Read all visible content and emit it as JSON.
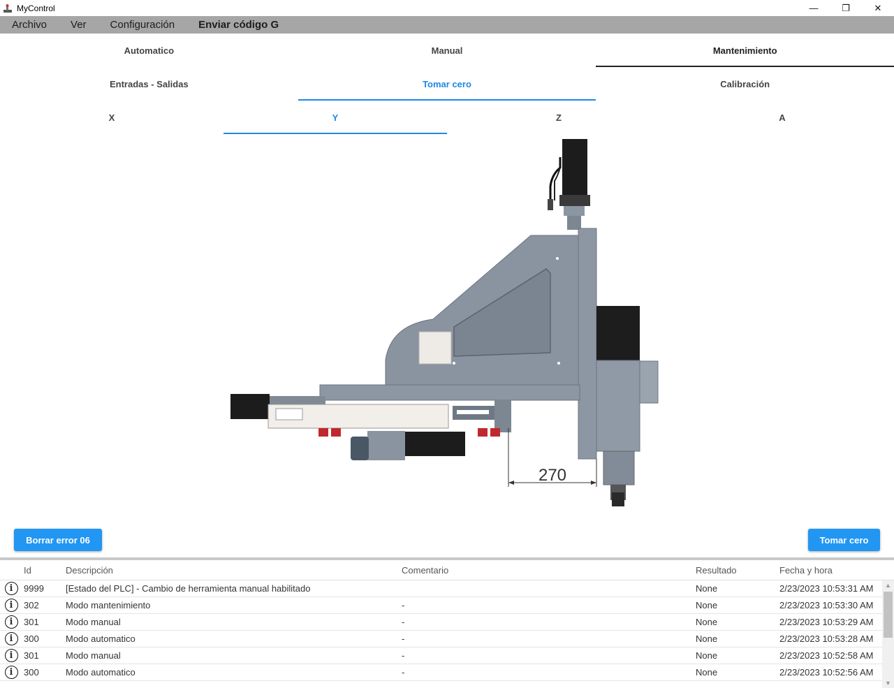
{
  "window": {
    "title": "MyControl",
    "minimize": "—",
    "maximize": "❐",
    "close": "✕"
  },
  "menu": {
    "archivo": "Archivo",
    "ver": "Ver",
    "configuracion": "Configuración",
    "enviar": "Enviar código G"
  },
  "tabs_main": [
    "Automatico",
    "Manual",
    "Mantenimiento"
  ],
  "tabs_sub": [
    "Entradas - Salidas",
    "Tomar cero",
    "Calibración"
  ],
  "tabs_axis": [
    "X",
    "Y",
    "Z",
    "A"
  ],
  "diagram": {
    "dimension": "270"
  },
  "buttons": {
    "clear_error": "Borrar error 06",
    "take_zero": "Tomar cero"
  },
  "table": {
    "headers": {
      "id": "Id",
      "desc": "Descripción",
      "comment": "Comentario",
      "result": "Resultado",
      "date": "Fecha y hora"
    },
    "rows": [
      {
        "id": "9999",
        "desc": "[Estado del PLC] - Cambio de herramienta manual habilitado",
        "comment": "",
        "result": "None",
        "date": "2/23/2023 10:53:31 AM"
      },
      {
        "id": "302",
        "desc": "Modo mantenimiento",
        "comment": "-",
        "result": "None",
        "date": "2/23/2023 10:53:30 AM"
      },
      {
        "id": "301",
        "desc": "Modo manual",
        "comment": "-",
        "result": "None",
        "date": "2/23/2023 10:53:29 AM"
      },
      {
        "id": "300",
        "desc": "Modo automatico",
        "comment": "-",
        "result": "None",
        "date": "2/23/2023 10:53:28 AM"
      },
      {
        "id": "301",
        "desc": "Modo manual",
        "comment": "-",
        "result": "None",
        "date": "2/23/2023 10:52:58 AM"
      },
      {
        "id": "300",
        "desc": "Modo automatico",
        "comment": "-",
        "result": "None",
        "date": "2/23/2023 10:52:56 AM"
      }
    ]
  }
}
